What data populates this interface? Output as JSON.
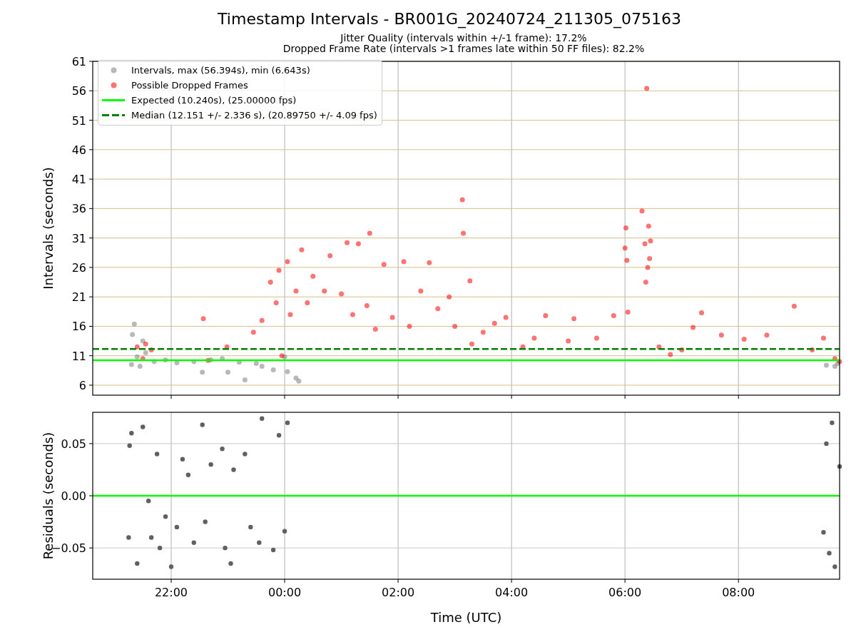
{
  "title": "Timestamp Intervals - BR001G_20240724_211305_075163",
  "subtitles": [
    "Jitter Quality (intervals within +/-1 frame): 17.2%",
    "Dropped Frame Rate (intervals >1 frames late within 50 FF files): 82.2%"
  ],
  "intervals_panel": {
    "chart_data": {
      "type": "scatter",
      "ylabel": "Intervals (seconds)",
      "grid": true,
      "xlim": [
        "2024-07-24T20:37",
        "2024-07-25T09:47"
      ],
      "ylim": [
        4.3,
        61
      ],
      "yticks": [
        {
          "value": 6,
          "label": "6"
        },
        {
          "value": 11,
          "label": "11"
        },
        {
          "value": 16,
          "label": "16"
        },
        {
          "value": 21,
          "label": "21"
        },
        {
          "value": 26,
          "label": "26"
        },
        {
          "value": 31,
          "label": "31"
        },
        {
          "value": 36,
          "label": "36"
        },
        {
          "value": 41,
          "label": "41"
        },
        {
          "value": 46,
          "label": "46"
        },
        {
          "value": 51,
          "label": "51"
        },
        {
          "value": 56,
          "label": "56"
        },
        {
          "value": 61,
          "label": "61"
        }
      ],
      "series": [
        {
          "name": "Intervals, max (56.394s), min (6.643s)",
          "color": "#808080",
          "x": [
            "2024-07-24T21:18",
            "2024-07-24T21:19",
            "2024-07-24T21:21",
            "2024-07-24T21:24",
            "2024-07-24T21:27",
            "2024-07-24T21:30",
            "2024-07-24T21:33",
            "2024-07-24T21:42",
            "2024-07-24T21:54",
            "2024-07-24T22:06",
            "2024-07-24T22:24",
            "2024-07-24T22:33",
            "2024-07-24T22:42",
            "2024-07-24T22:54",
            "2024-07-24T23:00",
            "2024-07-24T23:12",
            "2024-07-24T23:18",
            "2024-07-24T23:30",
            "2024-07-24T23:36",
            "2024-07-24T23:48",
            "2024-07-25T00:00",
            "2024-07-25T00:03",
            "2024-07-25T00:12",
            "2024-07-25T00:15",
            "2024-07-25T09:33",
            "2024-07-25T09:42",
            "2024-07-25T09:45"
          ],
          "values": [
            9.5,
            14.6,
            16.4,
            10.8,
            9.2,
            13.5,
            11.5,
            10,
            10.3,
            9.8,
            10,
            8.2,
            10.3,
            10.5,
            8.2,
            9.9,
            6.9,
            9.7,
            9.2,
            8.6,
            10.8,
            8.3,
            7.2,
            6.7,
            9.4,
            9.2,
            9.7
          ]
        },
        {
          "name": "Possible Dropped Frames",
          "color": "#ff0000",
          "x": [
            "2024-07-24T21:24",
            "2024-07-24T21:30",
            "2024-07-24T21:33",
            "2024-07-24T21:39",
            "2024-07-24T22:34",
            "2024-07-24T22:39",
            "2024-07-24T22:59",
            "2024-07-24T23:27",
            "2024-07-24T23:36",
            "2024-07-24T23:45",
            "2024-07-24T23:51",
            "2024-07-24T23:54",
            "2024-07-24T23:57",
            "2024-07-25T00:03",
            "2024-07-25T00:06",
            "2024-07-25T00:12",
            "2024-07-25T00:18",
            "2024-07-25T00:24",
            "2024-07-25T00:30",
            "2024-07-25T00:42",
            "2024-07-25T00:48",
            "2024-07-25T01:00",
            "2024-07-25T01:06",
            "2024-07-25T01:12",
            "2024-07-25T01:18",
            "2024-07-25T01:27",
            "2024-07-25T01:30",
            "2024-07-25T01:36",
            "2024-07-25T01:45",
            "2024-07-25T01:54",
            "2024-07-25T02:06",
            "2024-07-25T02:12",
            "2024-07-25T02:24",
            "2024-07-25T02:33",
            "2024-07-25T02:42",
            "2024-07-25T02:54",
            "2024-07-25T03:00",
            "2024-07-25T03:08",
            "2024-07-25T03:09",
            "2024-07-25T03:16",
            "2024-07-25T03:18",
            "2024-07-25T03:30",
            "2024-07-25T03:42",
            "2024-07-25T03:54",
            "2024-07-25T04:12",
            "2024-07-25T04:24",
            "2024-07-25T04:36",
            "2024-07-25T05:00",
            "2024-07-25T05:06",
            "2024-07-25T05:30",
            "2024-07-25T05:48",
            "2024-07-25T06:00",
            "2024-07-25T06:01",
            "2024-07-25T06:02",
            "2024-07-25T06:03",
            "2024-07-25T06:18",
            "2024-07-25T06:21",
            "2024-07-25T06:22",
            "2024-07-25T06:23",
            "2024-07-25T06:24",
            "2024-07-25T06:25",
            "2024-07-25T06:26",
            "2024-07-25T06:27",
            "2024-07-25T06:36",
            "2024-07-25T06:48",
            "2024-07-25T07:00",
            "2024-07-25T07:12",
            "2024-07-25T07:21",
            "2024-07-25T07:42",
            "2024-07-25T08:06",
            "2024-07-25T08:30",
            "2024-07-25T08:59",
            "2024-07-25T09:18",
            "2024-07-25T09:30",
            "2024-07-25T09:42",
            "2024-07-25T09:47"
          ],
          "values": [
            12.5,
            10.5,
            13,
            12,
            17.3,
            10.2,
            12.5,
            15,
            17,
            23.5,
            20,
            25.5,
            11,
            27,
            18,
            22,
            29,
            20,
            24.5,
            22,
            28,
            21.5,
            30.2,
            18,
            30,
            19.5,
            31.8,
            15.5,
            26.5,
            17.5,
            27,
            16,
            22,
            26.8,
            19,
            21,
            16,
            37.5,
            31.8,
            23.7,
            13,
            15,
            16.5,
            17.5,
            12.5,
            14,
            17.8,
            13.5,
            17.3,
            14,
            17.8,
            29.3,
            32.7,
            27.2,
            18.4,
            35.6,
            30,
            23.5,
            56.4,
            26,
            33,
            27.5,
            30.5,
            12.5,
            11.2,
            12,
            15.8,
            18.3,
            14.5,
            13.8,
            14.5,
            19.4,
            12,
            14,
            10.5,
            10
          ]
        }
      ],
      "ref_lines": [
        {
          "axis": "y",
          "value": 10.24,
          "label": "Expected (10.240s), (25.00000 fps)",
          "color": "#00ff00"
        },
        {
          "axis": "y",
          "value": 12.151,
          "label": "Median (12.151 +/- 2.336 s), (20.89750 +/- 4.09 fps)",
          "color": "#008000"
        }
      ]
    }
  },
  "residuals_panel": {
    "chart_data": {
      "type": "scatter",
      "xlabel": "Time (UTC)",
      "ylabel": "Residuals (seconds)",
      "grid": true,
      "xlim": [
        "2024-07-24T20:37",
        "2024-07-25T09:47"
      ],
      "ylim": [
        -0.08,
        0.08
      ],
      "xticks": [
        {
          "value": "2024-07-24T22:00",
          "label": "22:00"
        },
        {
          "value": "2024-07-25T00:00",
          "label": "00:00"
        },
        {
          "value": "2024-07-25T02:00",
          "label": "02:00"
        },
        {
          "value": "2024-07-25T04:00",
          "label": "04:00"
        },
        {
          "value": "2024-07-25T06:00",
          "label": "06:00"
        },
        {
          "value": "2024-07-25T08:00",
          "label": "08:00"
        }
      ],
      "yticks": [
        {
          "value": -0.05,
          "label": "−0.05"
        },
        {
          "value": 0,
          "label": "0.00"
        },
        {
          "value": 0.05,
          "label": "0.05"
        }
      ],
      "series": [
        {
          "color": "#606060",
          "x": [
            "2024-07-24T21:15",
            "2024-07-24T21:16",
            "2024-07-24T21:18",
            "2024-07-24T21:24",
            "2024-07-24T21:30",
            "2024-07-24T21:36",
            "2024-07-24T21:39",
            "2024-07-24T21:45",
            "2024-07-24T21:48",
            "2024-07-24T21:54",
            "2024-07-24T22:00",
            "2024-07-24T22:06",
            "2024-07-24T22:12",
            "2024-07-24T22:18",
            "2024-07-24T22:24",
            "2024-07-24T22:33",
            "2024-07-24T22:36",
            "2024-07-24T22:42",
            "2024-07-24T22:54",
            "2024-07-24T22:57",
            "2024-07-24T23:03",
            "2024-07-24T23:06",
            "2024-07-24T23:18",
            "2024-07-24T23:24",
            "2024-07-24T23:33",
            "2024-07-24T23:36",
            "2024-07-24T23:48",
            "2024-07-24T23:54",
            "2024-07-25T00:00",
            "2024-07-25T00:03",
            "2024-07-25T09:30",
            "2024-07-25T09:33",
            "2024-07-25T09:36",
            "2024-07-25T09:39",
            "2024-07-25T09:42",
            "2024-07-25T09:47"
          ],
          "values": [
            -0.04,
            0.048,
            0.06,
            -0.065,
            0.066,
            -0.005,
            -0.04,
            0.04,
            -0.05,
            -0.02,
            -0.068,
            -0.03,
            0.035,
            0.02,
            -0.045,
            0.068,
            -0.025,
            0.03,
            0.045,
            -0.05,
            -0.065,
            0.025,
            0.04,
            -0.03,
            -0.045,
            0.074,
            -0.052,
            0.058,
            -0.034,
            0.07,
            -0.035,
            0.05,
            -0.055,
            0.07,
            -0.068,
            0.028
          ]
        }
      ],
      "ref_lines": [
        {
          "axis": "y",
          "value": 0,
          "color": "#00ff00"
        }
      ]
    }
  }
}
